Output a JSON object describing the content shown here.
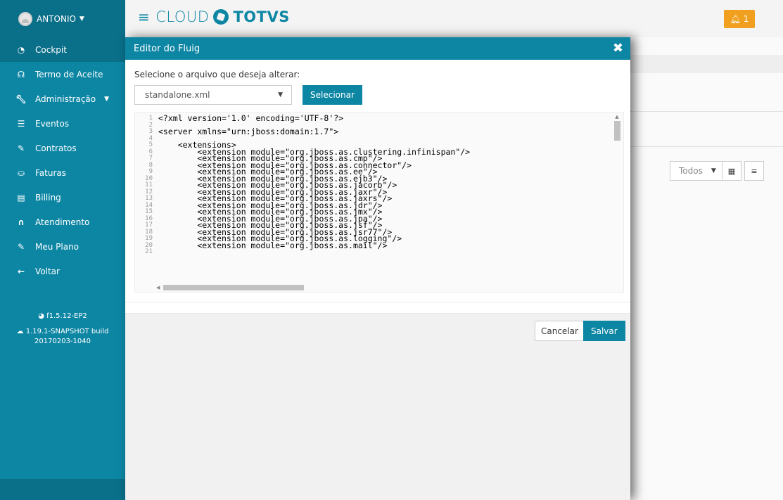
{
  "user": {
    "name": "ANTONIO"
  },
  "sidebar": {
    "items": [
      {
        "label": "Cockpit",
        "icon": "dashboard-icon"
      },
      {
        "label": "Termo de Aceite",
        "icon": "handshake-icon"
      },
      {
        "label": "Administração",
        "icon": "wrench-icon"
      },
      {
        "label": "Eventos",
        "icon": "list-icon"
      },
      {
        "label": "Contratos",
        "icon": "edit-icon"
      },
      {
        "label": "Faturas",
        "icon": "cash-icon"
      },
      {
        "label": "Billing",
        "icon": "file-icon"
      },
      {
        "label": "Atendimento",
        "icon": "headset-icon"
      },
      {
        "label": "Meu Plano",
        "icon": "edit-icon"
      },
      {
        "label": "Voltar",
        "icon": "arrow-left-icon"
      }
    ],
    "version_fluig": "f1.5.12-EP2",
    "version_build": "1.19.1-SNAPSHOT build",
    "version_date": "20170203-1040"
  },
  "topbar": {
    "logo_cloud": "CLOUD",
    "logo_brand": "TOTVS",
    "notifications": "1"
  },
  "background": {
    "filter_value": "Todos"
  },
  "modal": {
    "title": "Editor do Fluig",
    "select_label": "Selecione o arquivo que deseja alterar:",
    "file_value": "standalone.xml",
    "select_button": "Selecionar",
    "cancel_button": "Cancelar",
    "save_button": "Salvar",
    "code_lines": [
      "<?xml version='1.0' encoding='UTF-8'?>",
      "",
      "<server xmlns=\"urn:jboss:domain:1.7\">",
      "",
      "    <extensions>",
      "        <extension module=\"org.jboss.as.clustering.infinispan\"/>",
      "        <extension module=\"org.jboss.as.cmp\"/>",
      "        <extension module=\"org.jboss.as.connector\"/>",
      "        <extension module=\"org.jboss.as.ee\"/>",
      "        <extension module=\"org.jboss.as.ejb3\"/>",
      "        <extension module=\"org.jboss.as.jacorb\"/>",
      "        <extension module=\"org.jboss.as.jaxr\"/>",
      "        <extension module=\"org.jboss.as.jaxrs\"/>",
      "        <extension module=\"org.jboss.as.jdr\"/>",
      "        <extension module=\"org.jboss.as.jmx\"/>",
      "        <extension module=\"org.jboss.as.jpa\"/>",
      "        <extension module=\"org.jboss.as.jsf\"/>",
      "        <extension module=\"org.jboss.as.jsr77\"/>",
      "        <extension module=\"org.jboss.as.logging\"/>",
      "        <extension module=\"org.jboss.as.mail\"/>",
      ""
    ]
  },
  "colors": {
    "primary": "#0d86a4",
    "primary_dark": "#0a6f89",
    "notification": "#f0a01e"
  }
}
